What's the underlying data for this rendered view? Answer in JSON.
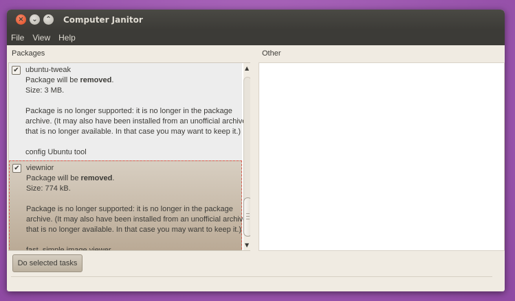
{
  "window": {
    "title": "Computer Janitor"
  },
  "menu": [
    "File",
    "View",
    "Help"
  ],
  "columns": {
    "packages": "Packages",
    "other": "Other"
  },
  "packages": [
    {
      "checked": true,
      "name": "ubuntu-tweak",
      "action_prefix": "Package will be ",
      "action_bold": "removed",
      "action_suffix": ".",
      "size": "Size: 3 MB.",
      "desc1": "Package is no longer supported: it is no longer in the package",
      "desc2": "archive. (It may also have been installed from an unofficial archive",
      "desc3": "that is no longer available. In that case you may want to keep it.)",
      "summary": "config Ubuntu tool"
    },
    {
      "checked": true,
      "name": "viewnior",
      "action_prefix": "Package will be ",
      "action_bold": "removed",
      "action_suffix": ".",
      "size": "Size: 774 kB.",
      "desc1": "Package is no longer supported: it is no longer in the package",
      "desc2": "archive. (It may also have been installed from an unofficial archive",
      "desc3": "that is no longer available. In that case you may want to keep it.)",
      "summary": "fast, simple image viewer"
    }
  ],
  "buttons": {
    "do_selected": "Do selected tasks"
  },
  "icons": {
    "close": "close-icon",
    "minimize": "minimize-icon",
    "maximize": "maximize-icon",
    "check": "✔",
    "up": "▲",
    "down": "▼"
  }
}
